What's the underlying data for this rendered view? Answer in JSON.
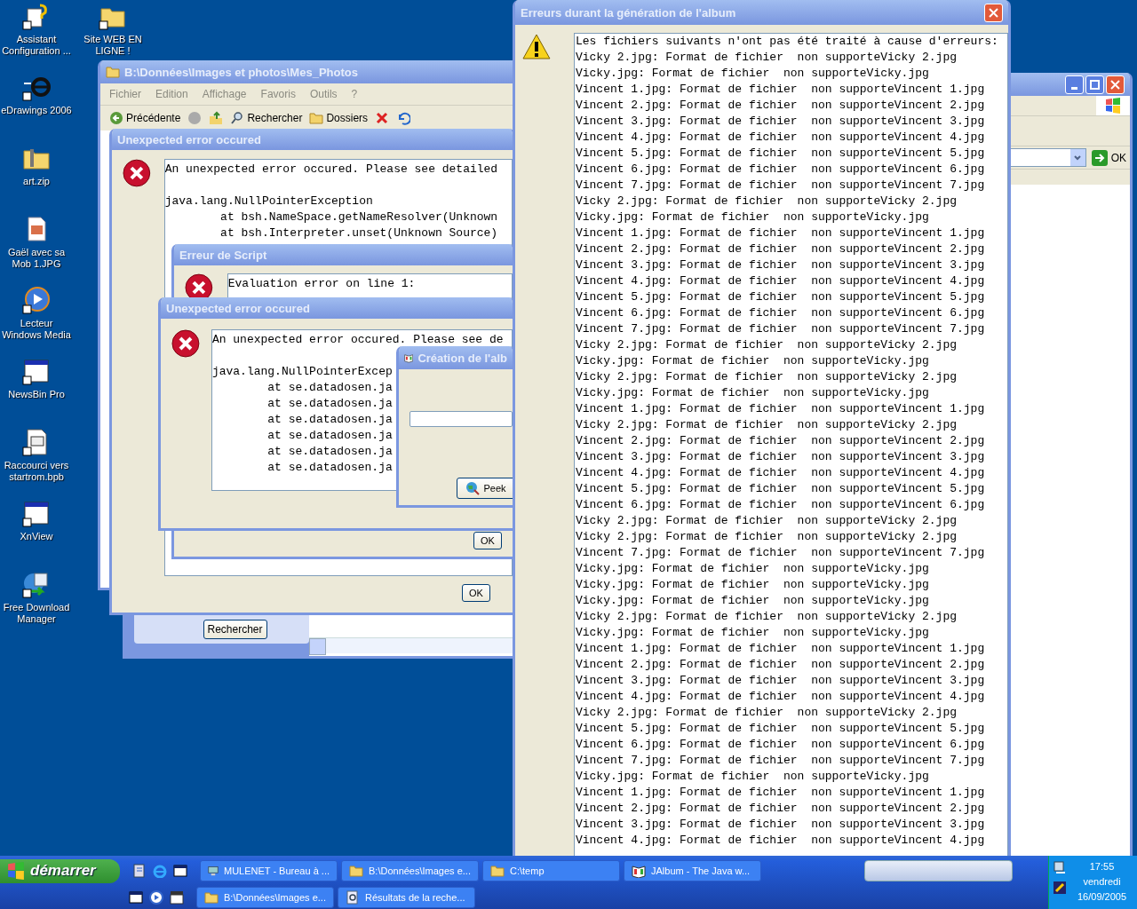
{
  "desktop_icons": [
    {
      "label": "Assistant Configuration ...",
      "kind": "wizard"
    },
    {
      "label": "Site WEB EN LIGNE !",
      "kind": "folder"
    },
    {
      "label": "eDrawings 2006",
      "kind": "app"
    },
    {
      "label": "art.zip",
      "kind": "zip"
    },
    {
      "label": "Gaël avec sa Mob 1.JPG",
      "kind": "image"
    },
    {
      "label": "Lecteur Windows Media",
      "kind": "media"
    },
    {
      "label": "NewsBin Pro",
      "kind": "window"
    },
    {
      "label": "Raccourci vers startrom.bpb",
      "kind": "document"
    },
    {
      "label": "XnView",
      "kind": "window"
    },
    {
      "label": "Free Download Manager",
      "kind": "download"
    }
  ],
  "search_window": {
    "button": "Rechercher"
  },
  "explorer_window": {
    "title": "B:\\Données\\Images et photos\\Mes_Photos",
    "menu": [
      "Fichier",
      "Edition",
      "Affichage",
      "Favoris",
      "Outils",
      "?"
    ],
    "back_button": "Précédente",
    "search_button": "Rechercher",
    "folders_button": "Dossiers"
  },
  "right_window": {
    "go_button": "OK"
  },
  "error_dialog": {
    "title": "Unexpected error occured",
    "paragraphs": [
      [
        "An unexpected error occured. Please see detailed"
      ],
      [
        "java.lang.NullPointerException",
        "        at bsh.NameSpace.getNameResolver(Unknown",
        "        at bsh.Interpreter.unset(Unknown Source)"
      ]
    ],
    "button": "OK"
  },
  "script_dialog": {
    "title": "Erreur de Script",
    "lines": [
      "Evaluation error on line 1:"
    ],
    "button": "OK"
  },
  "error_dialog_2": {
    "title": "Unexpected error occured",
    "paragraphs": [
      [
        "An unexpected error occured. Please see de"
      ],
      [
        "java.lang.NullPointerExcep",
        "        at se.datadosen.ja",
        "        at se.datadosen.ja",
        "        at se.datadosen.ja",
        "        at se.datadosen.ja",
        "        at se.datadosen.ja",
        "        at se.datadosen.ja"
      ]
    ]
  },
  "album_dialog": {
    "title": "Création de l'alb",
    "button": "Peek"
  },
  "errors_window": {
    "title": "Erreurs durant la génération de l'album",
    "lines": [
      "Les fichiers suivants n'ont pas été traité à cause d'erreurs:",
      "Vicky 2.jpg: Format de fichier  non supporteVicky 2.jpg",
      "Vicky.jpg: Format de fichier  non supporteVicky.jpg",
      "Vincent 1.jpg: Format de fichier  non supporteVincent 1.jpg",
      "Vincent 2.jpg: Format de fichier  non supporteVincent 2.jpg",
      "Vincent 3.jpg: Format de fichier  non supporteVincent 3.jpg",
      "Vincent 4.jpg: Format de fichier  non supporteVincent 4.jpg",
      "Vincent 5.jpg: Format de fichier  non supporteVincent 5.jpg",
      "Vincent 6.jpg: Format de fichier  non supporteVincent 6.jpg",
      "Vincent 7.jpg: Format de fichier  non supporteVincent 7.jpg",
      "Vicky 2.jpg: Format de fichier  non supporteVicky 2.jpg",
      "Vicky.jpg: Format de fichier  non supporteVicky.jpg",
      "Vincent 1.jpg: Format de fichier  non supporteVincent 1.jpg",
      "Vincent 2.jpg: Format de fichier  non supporteVincent 2.jpg",
      "Vincent 3.jpg: Format de fichier  non supporteVincent 3.jpg",
      "Vincent 4.jpg: Format de fichier  non supporteVincent 4.jpg",
      "Vincent 5.jpg: Format de fichier  non supporteVincent 5.jpg",
      "Vincent 6.jpg: Format de fichier  non supporteVincent 6.jpg",
      "Vincent 7.jpg: Format de fichier  non supporteVincent 7.jpg",
      "Vicky 2.jpg: Format de fichier  non supporteVicky 2.jpg",
      "Vicky.jpg: Format de fichier  non supporteVicky.jpg",
      "Vicky 2.jpg: Format de fichier  non supporteVicky 2.jpg",
      "Vicky.jpg: Format de fichier  non supporteVicky.jpg",
      "Vincent 1.jpg: Format de fichier  non supporteVincent 1.jpg",
      "Vicky 2.jpg: Format de fichier  non supporteVicky 2.jpg",
      "Vincent 2.jpg: Format de fichier  non supporteVincent 2.jpg",
      "Vincent 3.jpg: Format de fichier  non supporteVincent 3.jpg",
      "Vincent 4.jpg: Format de fichier  non supporteVincent 4.jpg",
      "Vincent 5.jpg: Format de fichier  non supporteVincent 5.jpg",
      "Vincent 6.jpg: Format de fichier  non supporteVincent 6.jpg",
      "Vicky 2.jpg: Format de fichier  non supporteVicky 2.jpg",
      "Vicky 2.jpg: Format de fichier  non supporteVicky 2.jpg",
      "Vincent 7.jpg: Format de fichier  non supporteVincent 7.jpg",
      "Vicky.jpg: Format de fichier  non supporteVicky.jpg",
      "Vicky.jpg: Format de fichier  non supporteVicky.jpg",
      "Vicky.jpg: Format de fichier  non supporteVicky.jpg",
      "Vicky 2.jpg: Format de fichier  non supporteVicky 2.jpg",
      "Vicky.jpg: Format de fichier  non supporteVicky.jpg",
      "Vincent 1.jpg: Format de fichier  non supporteVincent 1.jpg",
      "Vincent 2.jpg: Format de fichier  non supporteVincent 2.jpg",
      "Vincent 3.jpg: Format de fichier  non supporteVincent 3.jpg",
      "Vincent 4.jpg: Format de fichier  non supporteVincent 4.jpg",
      "Vicky 2.jpg: Format de fichier  non supporteVicky 2.jpg",
      "Vincent 5.jpg: Format de fichier  non supporteVincent 5.jpg",
      "Vincent 6.jpg: Format de fichier  non supporteVincent 6.jpg",
      "Vincent 7.jpg: Format de fichier  non supporteVincent 7.jpg",
      "Vicky.jpg: Format de fichier  non supporteVicky.jpg",
      "Vincent 1.jpg: Format de fichier  non supporteVincent 1.jpg",
      "Vincent 2.jpg: Format de fichier  non supporteVincent 2.jpg",
      "Vincent 3.jpg: Format de fichier  non supporteVincent 3.jpg",
      "Vincent 4.jpg: Format de fichier  non supporteVincent 4.jpg"
    ]
  },
  "taskbar": {
    "start": "démarrer",
    "row_1": [
      {
        "label": "MULENET - Bureau à ...",
        "kind": "remote"
      },
      {
        "label": "B:\\Données\\Images e...",
        "kind": "folder"
      },
      {
        "label": "C:\\temp",
        "kind": "folder"
      },
      {
        "label": "JAlbum - The Java w...",
        "kind": "album"
      }
    ],
    "row_2": [
      {
        "label": "B:\\Données\\Images e...",
        "kind": "folder"
      },
      {
        "label": "Résultats de la reche...",
        "kind": "search"
      }
    ],
    "clock": {
      "time": "17:55",
      "day": "vendredi",
      "date": "16/09/2005"
    }
  }
}
